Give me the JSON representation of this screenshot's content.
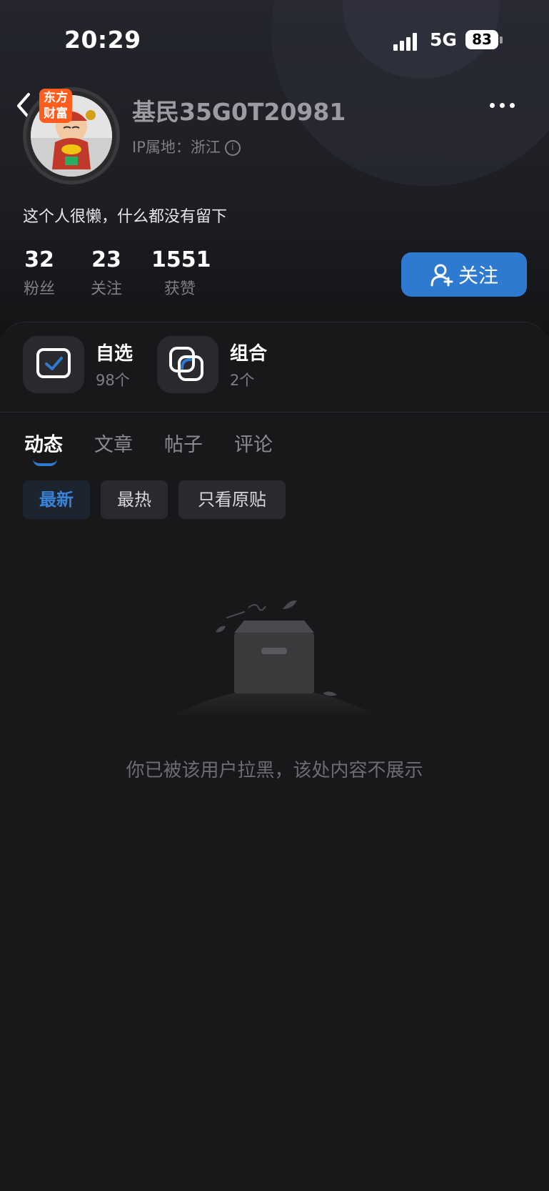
{
  "status_bar": {
    "time": "20:29",
    "network": "5G",
    "battery": "83"
  },
  "profile": {
    "brand_badge": "东方\n财富",
    "username": "基民35G0T20981",
    "ip_location": "IP属地：浙江",
    "bio": "这个人很懒，什么都没有留下",
    "stats": [
      {
        "value": "32",
        "label": "粉丝"
      },
      {
        "value": "23",
        "label": "关注"
      },
      {
        "value": "1551",
        "label": "获赞"
      }
    ],
    "follow_label": "关注"
  },
  "shortcuts": [
    {
      "title": "自选",
      "sub": "98个",
      "icon": "watchlist-icon"
    },
    {
      "title": "组合",
      "sub": "2个",
      "icon": "portfolio-icon"
    }
  ],
  "tabs": [
    "动态",
    "文章",
    "帖子",
    "评论"
  ],
  "filters": [
    "最新",
    "最热",
    "只看原贴"
  ],
  "empty_message": "你已被该用户拉黑，该处内容不展示",
  "colors": {
    "accent": "#2f7ad1",
    "background": "#18181a",
    "brand": "#ff5c1e"
  }
}
